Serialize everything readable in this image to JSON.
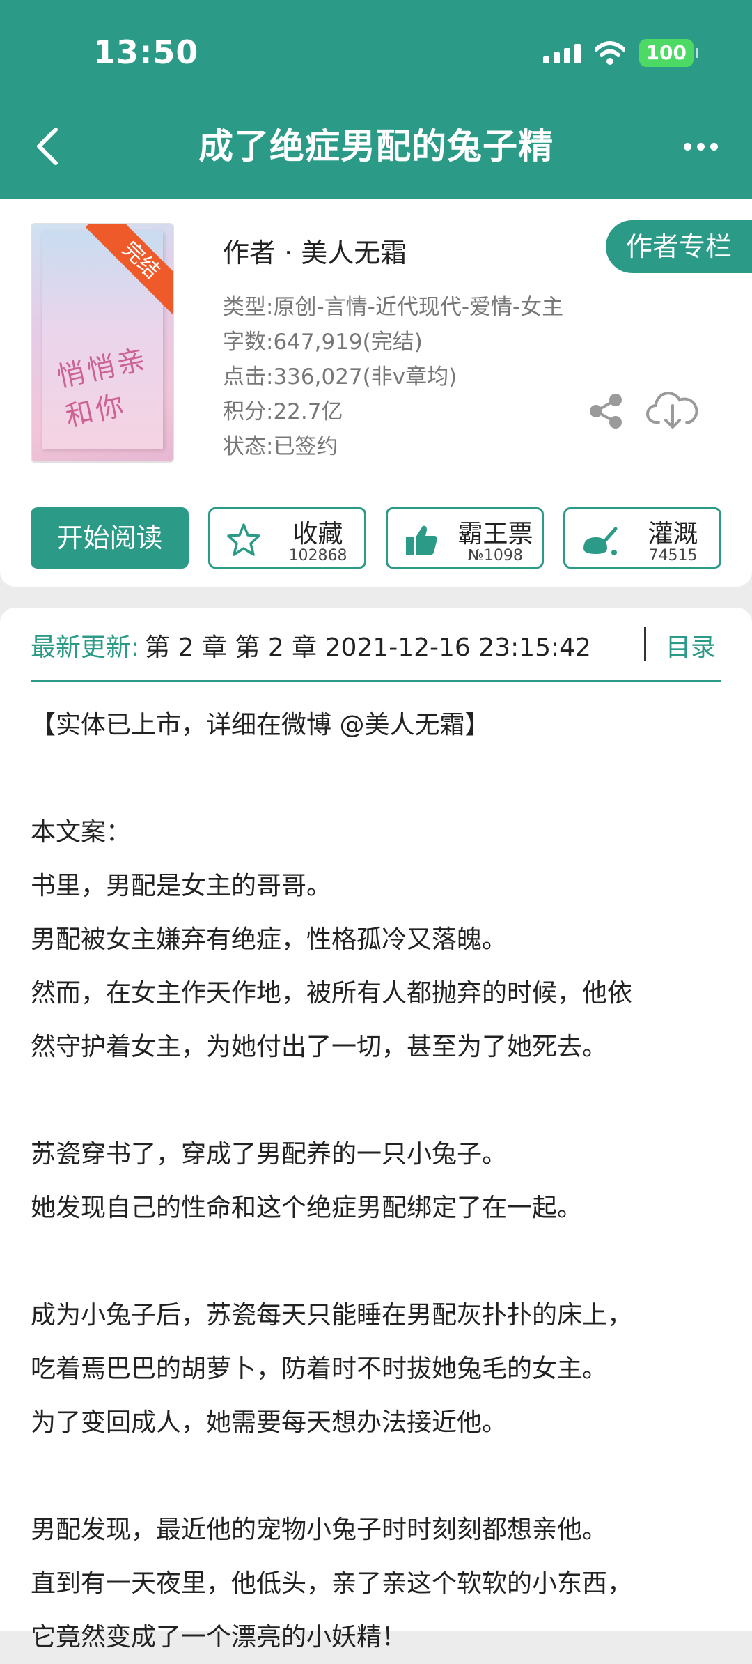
{
  "status_bar": {
    "time": "13:50",
    "battery": "100"
  },
  "header": {
    "title": "成了绝症男配的兔子精"
  },
  "book": {
    "cover_title": "悄悄亲和你",
    "badge": "完结",
    "author": "作者 · 美人无霜",
    "author_column_button": "作者专栏",
    "meta": [
      "类型:原创-言情-近代现代-爱情-女主",
      "字数:647,919(完结)",
      "点击:336,027(非v章均)",
      "积分:22.7亿",
      "状态:已签约"
    ]
  },
  "actions": {
    "read": "开始阅读",
    "favorite": {
      "label": "收藏",
      "count": "102868"
    },
    "vote": {
      "label": "霸王票",
      "count": "№1098"
    },
    "water": {
      "label": "灌溉",
      "count": "74515"
    }
  },
  "latest": {
    "label": "最新更新:",
    "value": "第 2 章 第 2 章 2021-12-16 23:15:42",
    "toc": "目录"
  },
  "intro_lines": [
    "【实体已上市，详细在微博 @美人无霜】",
    "",
    "本文案：",
    "书里，男配是女主的哥哥。",
    "男配被女主嫌弃有绝症，性格孤冷又落魄。",
    "然而，在女主作天作地，被所有人都抛弃的时候，他依",
    "然守护着女主，为她付出了一切，甚至为了她死去。",
    "",
    "苏瓷穿书了，穿成了男配养的一只小兔子。",
    "她发现自己的性命和这个绝症男配绑定了在一起。",
    "",
    "成为小兔子后，苏瓷每天只能睡在男配灰扑扑的床上，",
    "吃着焉巴巴的胡萝卜，防着时不时拔她兔毛的女主。",
    "为了变回成人，她需要每天想办法接近他。",
    "",
    "男配发现，最近他的宠物小兔子时时刻刻都想亲他。",
    "直到有一天夜里，他低头，亲了亲这个软软的小东西，",
    "它竟然变成了一个漂亮的小妖精！"
  ]
}
